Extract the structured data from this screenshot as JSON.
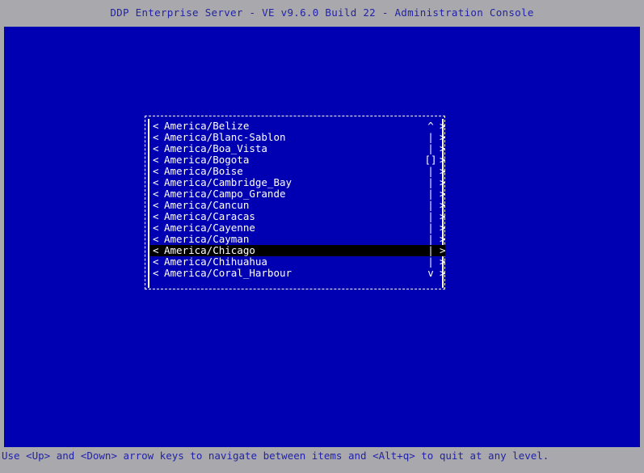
{
  "titlebar": {
    "title": "DDP Enterprise Server - VE v9.6.0 Build 22 - Administration Console"
  },
  "statusbar": {
    "hint": "Use <Up> and <Down> arrow keys to navigate between items and <Alt+q> to quit at any level."
  },
  "colors": {
    "console_background": "#0000b2",
    "chrome_background": "#a9a9ad",
    "chrome_text": "#2222a8",
    "list_text": "#ffffff",
    "selection_background": "#000000"
  },
  "dialog": {
    "left_marker": "<",
    "right_marker": ">",
    "scroll_up_glyph": "^",
    "scroll_down_glyph": "v",
    "scroll_track_glyph": "|",
    "scroll_thumb_glyph": "[]",
    "items": [
      {
        "label": "America/Belize",
        "scroll": "^",
        "selected": false
      },
      {
        "label": "America/Blanc-Sablon",
        "scroll": "|",
        "selected": false
      },
      {
        "label": "America/Boa_Vista",
        "scroll": "|",
        "selected": false
      },
      {
        "label": "America/Bogota",
        "scroll": "[]",
        "selected": false
      },
      {
        "label": "America/Boise",
        "scroll": "|",
        "selected": false
      },
      {
        "label": "America/Cambridge_Bay",
        "scroll": "|",
        "selected": false
      },
      {
        "label": "America/Campo_Grande",
        "scroll": "|",
        "selected": false
      },
      {
        "label": "America/Cancun",
        "scroll": "|",
        "selected": false
      },
      {
        "label": "America/Caracas",
        "scroll": "|",
        "selected": false
      },
      {
        "label": "America/Cayenne",
        "scroll": "|",
        "selected": false
      },
      {
        "label": "America/Cayman",
        "scroll": "|",
        "selected": false
      },
      {
        "label": "America/Chicago",
        "scroll": "|",
        "selected": true
      },
      {
        "label": "America/Chihuahua",
        "scroll": "|",
        "selected": false
      },
      {
        "label": "America/Coral_Harbour",
        "scroll": "v",
        "selected": false
      }
    ]
  }
}
